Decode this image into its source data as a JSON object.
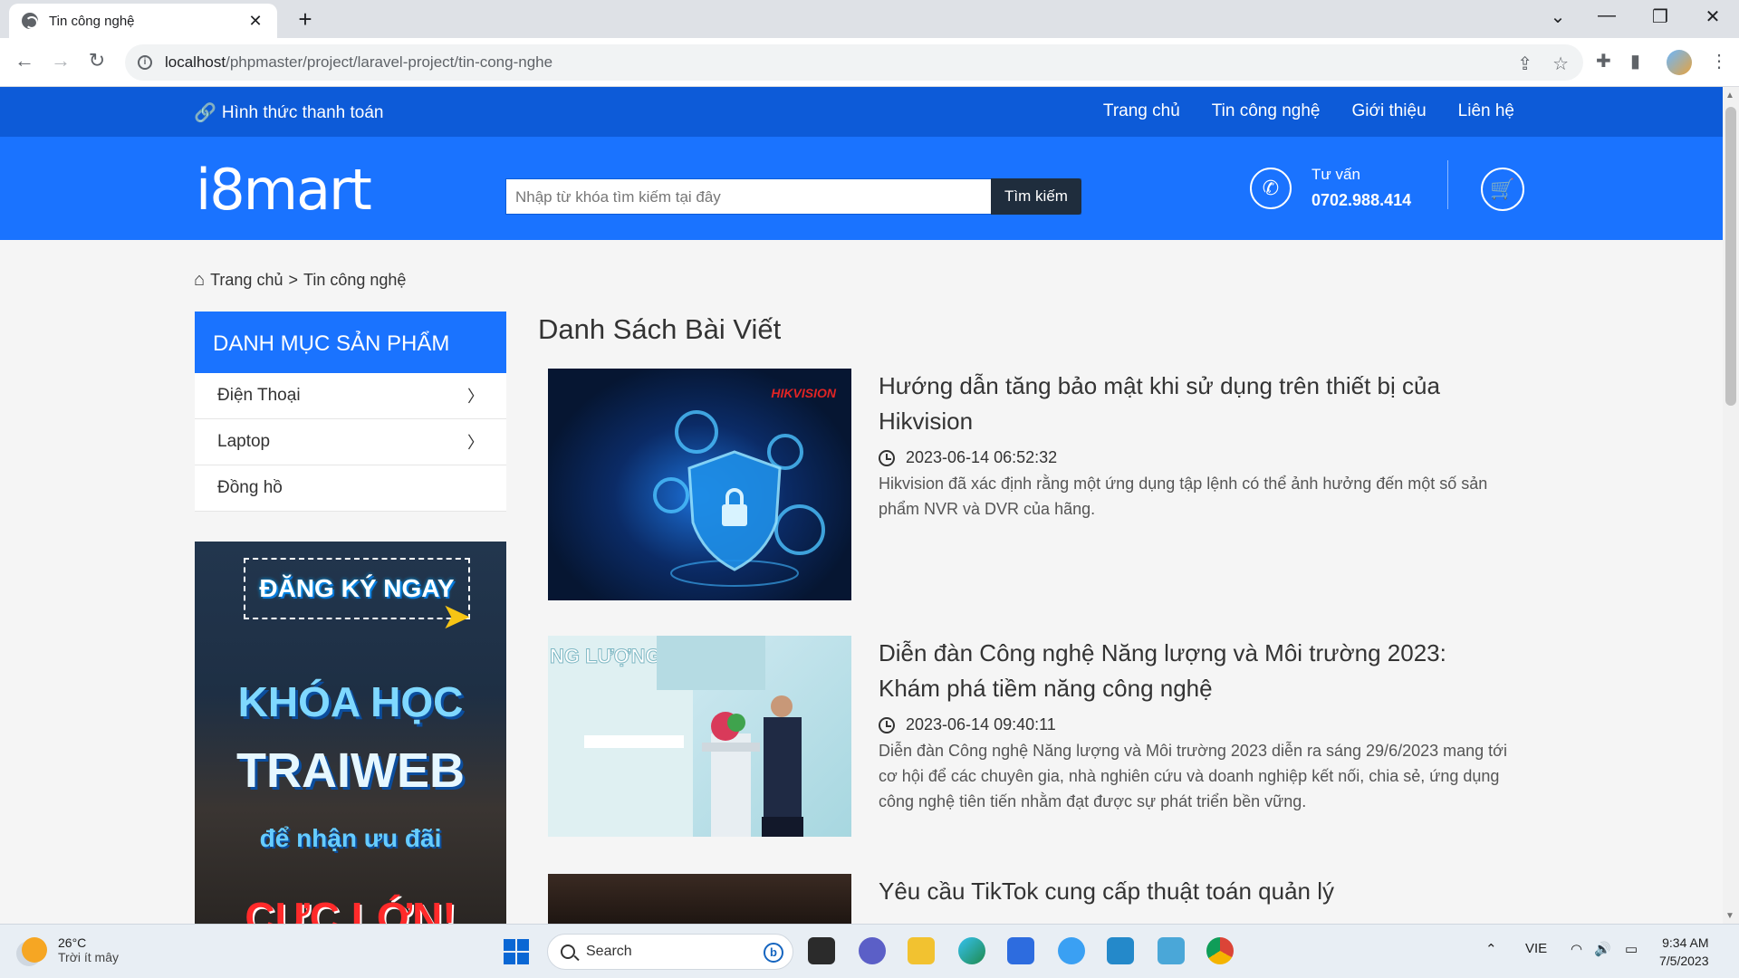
{
  "browser": {
    "tab_title": "Tin công nghệ",
    "tab_close": "✕",
    "new_tab": "+",
    "url_host": "localhost",
    "url_path": "/phpmaster/project/laravel-project/tin-cong-nghe"
  },
  "topbar": {
    "payment_label": "Hình thức thanh toán",
    "nav": [
      "Trang chủ",
      "Tin công nghệ",
      "Giới thiệu",
      "Liên hệ"
    ]
  },
  "header": {
    "logo": "i8mart",
    "search_placeholder": "Nhập từ khóa tìm kiếm tại đây",
    "search_button": "Tìm kiếm",
    "consult_label": "Tư vấn",
    "consult_phone": "0702.988.414"
  },
  "breadcrumb": {
    "home": "Trang chủ",
    "separator": ">",
    "current": "Tin công nghệ"
  },
  "sidebar": {
    "category_title": "DANH MỤC SẢN PHẨM",
    "categories": [
      {
        "label": "Điện Thoại",
        "has_sub": true
      },
      {
        "label": "Laptop",
        "has_sub": true
      },
      {
        "label": "Đồng hồ",
        "has_sub": false
      }
    ],
    "banner": {
      "register": "ĐĂNG KÝ NGAY",
      "line1": "KHÓA HỌC",
      "line2": "TRAIWEB",
      "line3": "để nhận ưu đãi",
      "line4": "CỰC LỚN!"
    }
  },
  "main": {
    "page_title": "Danh Sách Bài Viết",
    "posts": [
      {
        "title": "Hướng dẫn tăng bảo mật khi sử dụng trên thiết bị của Hikvision",
        "date": "2023-06-14 06:52:32",
        "excerpt": "Hikvision đã xác định rằng một ứng dụng tập lệnh có thể ảnh hưởng đến một số sản phẩm NVR và DVR của hãng.",
        "thumb_brand": "HIKVISION"
      },
      {
        "title": "Diễn đàn Công nghệ Năng lượng và Môi trường 2023: Khám phá tiềm năng công nghệ",
        "date": "2023-06-14 09:40:11",
        "excerpt": "Diễn đàn Công nghệ Năng lượng và Môi trường 2023 diễn ra sáng 29/6/2023 mang tới cơ hội để các chuyên gia, nhà nghiên cứu và doanh nghiệp kết nối, chia sẻ, ứng dụng công nghệ tiên tiến nhằm đạt được sự phát triển bền vững.",
        "thumb_text": "NG LƯỢNG"
      },
      {
        "title": "Yêu cầu TikTok cung cấp thuật toán quản lý"
      }
    ]
  },
  "taskbar": {
    "temperature": "26°C",
    "weather": "Trời ít mây",
    "search_label": "Search",
    "language": "VIE",
    "time": "9:34 AM",
    "date": "7/5/2023"
  }
}
